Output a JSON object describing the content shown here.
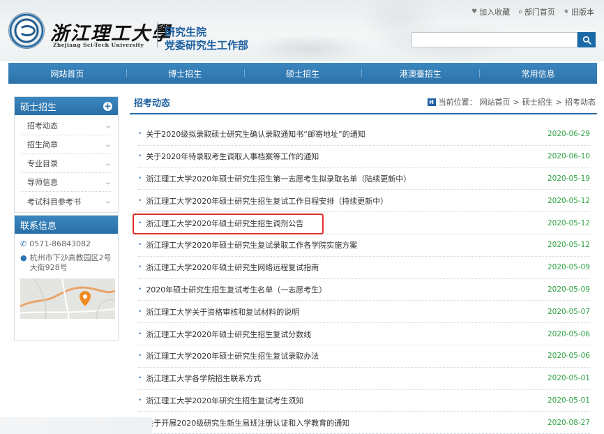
{
  "header": {
    "university_cn": "浙江理工大學",
    "university_en": "Zhejiang Sci-Tech University",
    "dept_line1": "研究生院",
    "dept_line2": "党委研究生工作部",
    "toplinks": [
      {
        "label": "加入收藏",
        "icon": "heart-icon"
      },
      {
        "label": "部门首页",
        "icon": "home-icon"
      },
      {
        "label": "旧版本",
        "icon": "star-icon"
      }
    ],
    "search": {
      "placeholder": "",
      "button_icon": "search-icon"
    }
  },
  "nav": {
    "items": [
      "网站首页",
      "博士招生",
      "硕士招生",
      "港澳臺招生",
      "常用信息"
    ]
  },
  "sidebar": {
    "section_title": "硕士招生",
    "items": [
      "招考动态",
      "招生简章",
      "专业目录",
      "导师信息",
      "考试科目参考书"
    ],
    "contact": {
      "title": "联系信息",
      "phone": "0571-86843082",
      "address": "杭州市下沙高教园区2号大街928号"
    }
  },
  "main": {
    "title": "招考动态",
    "breadcrumb": {
      "prefix": "当前位置：",
      "items": [
        "网站首页",
        "硕士招生",
        "招考动态"
      ],
      "separator": ">"
    },
    "news": [
      {
        "title": "关于2020级拟录取硕士研究生确认录取通知书“邮寄地址”的通知",
        "date": "2020-06-29"
      },
      {
        "title": "关于2020年待录取考生调取人事档案等工作的通知",
        "date": "2020-06-10"
      },
      {
        "title": "浙江理工大学2020年硕士研究生招生第一志愿考生拟录取名单（陆续更新中）",
        "date": "2020-05-19"
      },
      {
        "title": "浙江理工大学2020年硕士研究生招生复试工作日程安排（持续更新中）",
        "date": "2020-05-12"
      },
      {
        "title": "浙江理工大学2020年硕士研究生招生调剂公告",
        "date": "2020-05-12",
        "highlighted": true
      },
      {
        "title": "浙江理工大学2020年硕士研究生复试录取工作各学院实施方案",
        "date": "2020-05-12"
      },
      {
        "title": "浙江理工大学2020年硕士研究生网络远程复试指南",
        "date": "2020-05-09"
      },
      {
        "title": "2020年硕士研究生招生复试考生名单（一志愿考生）",
        "date": "2020-05-09"
      },
      {
        "title": "浙江理工大学关于资格审核和复试材料的说明",
        "date": "2020-05-07"
      },
      {
        "title": "浙江理工大学2020年硕士研究生招生复试分数线",
        "date": "2020-05-06"
      },
      {
        "title": "浙江理工大学2020年硕士研究生招生复试录取办法",
        "date": "2020-05-06"
      },
      {
        "title": "浙江理工大学各学院招生联系方式",
        "date": "2020-05-01"
      },
      {
        "title": "浙江理工大学2020年研究生招生复试考生须知",
        "date": "2020-05-01"
      },
      {
        "title": "关于开展2020级研究生新生易班注册认证和入学教育的通知",
        "date": "2020-08-27"
      }
    ]
  },
  "colors": {
    "brand_blue": "#2c72aa",
    "title_blue": "#1c5f9e",
    "date_green": "#2ea043",
    "highlight_red": "#e0302a"
  }
}
